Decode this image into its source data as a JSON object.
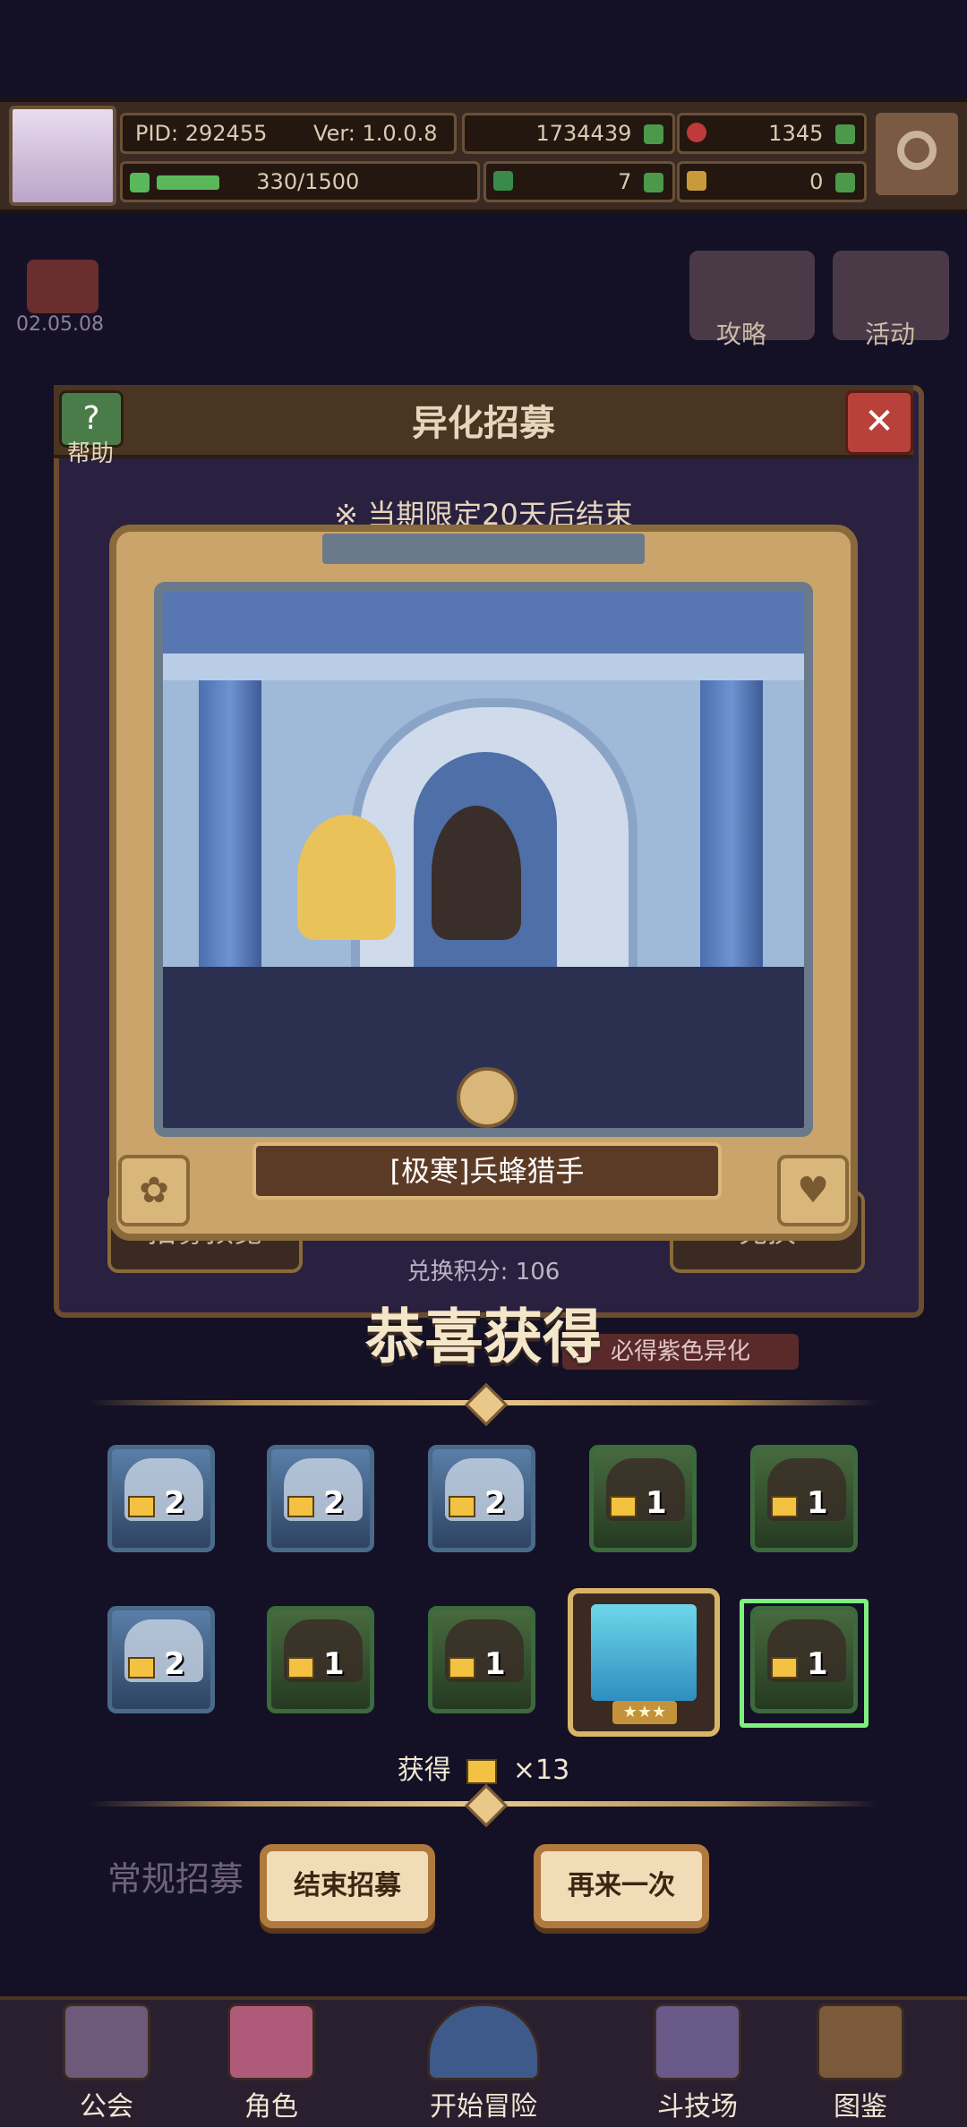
{
  "header": {
    "pid": "PID: 292455",
    "version": "Ver: 1.0.0.8",
    "gold": "1734439",
    "gems": "1345",
    "stamina": "330/1500",
    "clover": "7",
    "key": "0"
  },
  "background": {
    "date": "02.05.08",
    "guide_label": "攻略",
    "activity_label": "活动"
  },
  "recruit_panel": {
    "title": "异化招募",
    "help_label": "帮助",
    "close_label": "✕",
    "limited_notice": "※ 当期限定20天后结束",
    "points_label": "兑换积分: 106",
    "preview_label": "招募预览",
    "exchange_label": "兑换",
    "guarantee_label": "必得紫色异化"
  },
  "result_card": {
    "name": "[极寒]兵蜂猎手",
    "paw_icon": "paw-icon",
    "heart_icon": "heart-icon"
  },
  "congrats": "恭喜获得",
  "rewards": [
    {
      "count": "2",
      "style": "blue"
    },
    {
      "count": "2",
      "style": "blue"
    },
    {
      "count": "2",
      "style": "blue"
    },
    {
      "count": "1",
      "style": "green"
    },
    {
      "count": "1",
      "style": "green"
    },
    {
      "count": "2",
      "style": "blue"
    },
    {
      "count": "1",
      "style": "green"
    },
    {
      "count": "1",
      "style": "green"
    },
    {
      "count": "",
      "style": "special",
      "stars": "★★★"
    },
    {
      "count": "1",
      "style": "green",
      "selected": true
    }
  ],
  "obtained_text": "获得",
  "obtained_count": "×13",
  "buttons": {
    "end_recruit": "结束招募",
    "again": "再来一次"
  },
  "bottom_nav": [
    {
      "label": "公会"
    },
    {
      "label": "角色"
    },
    {
      "label": "开始冒险"
    },
    {
      "label": "斗技场"
    },
    {
      "label": "图鉴"
    }
  ],
  "colors": {
    "frame_gold": "#caa46a",
    "select_green": "#7df07d",
    "background": "#141126"
  }
}
